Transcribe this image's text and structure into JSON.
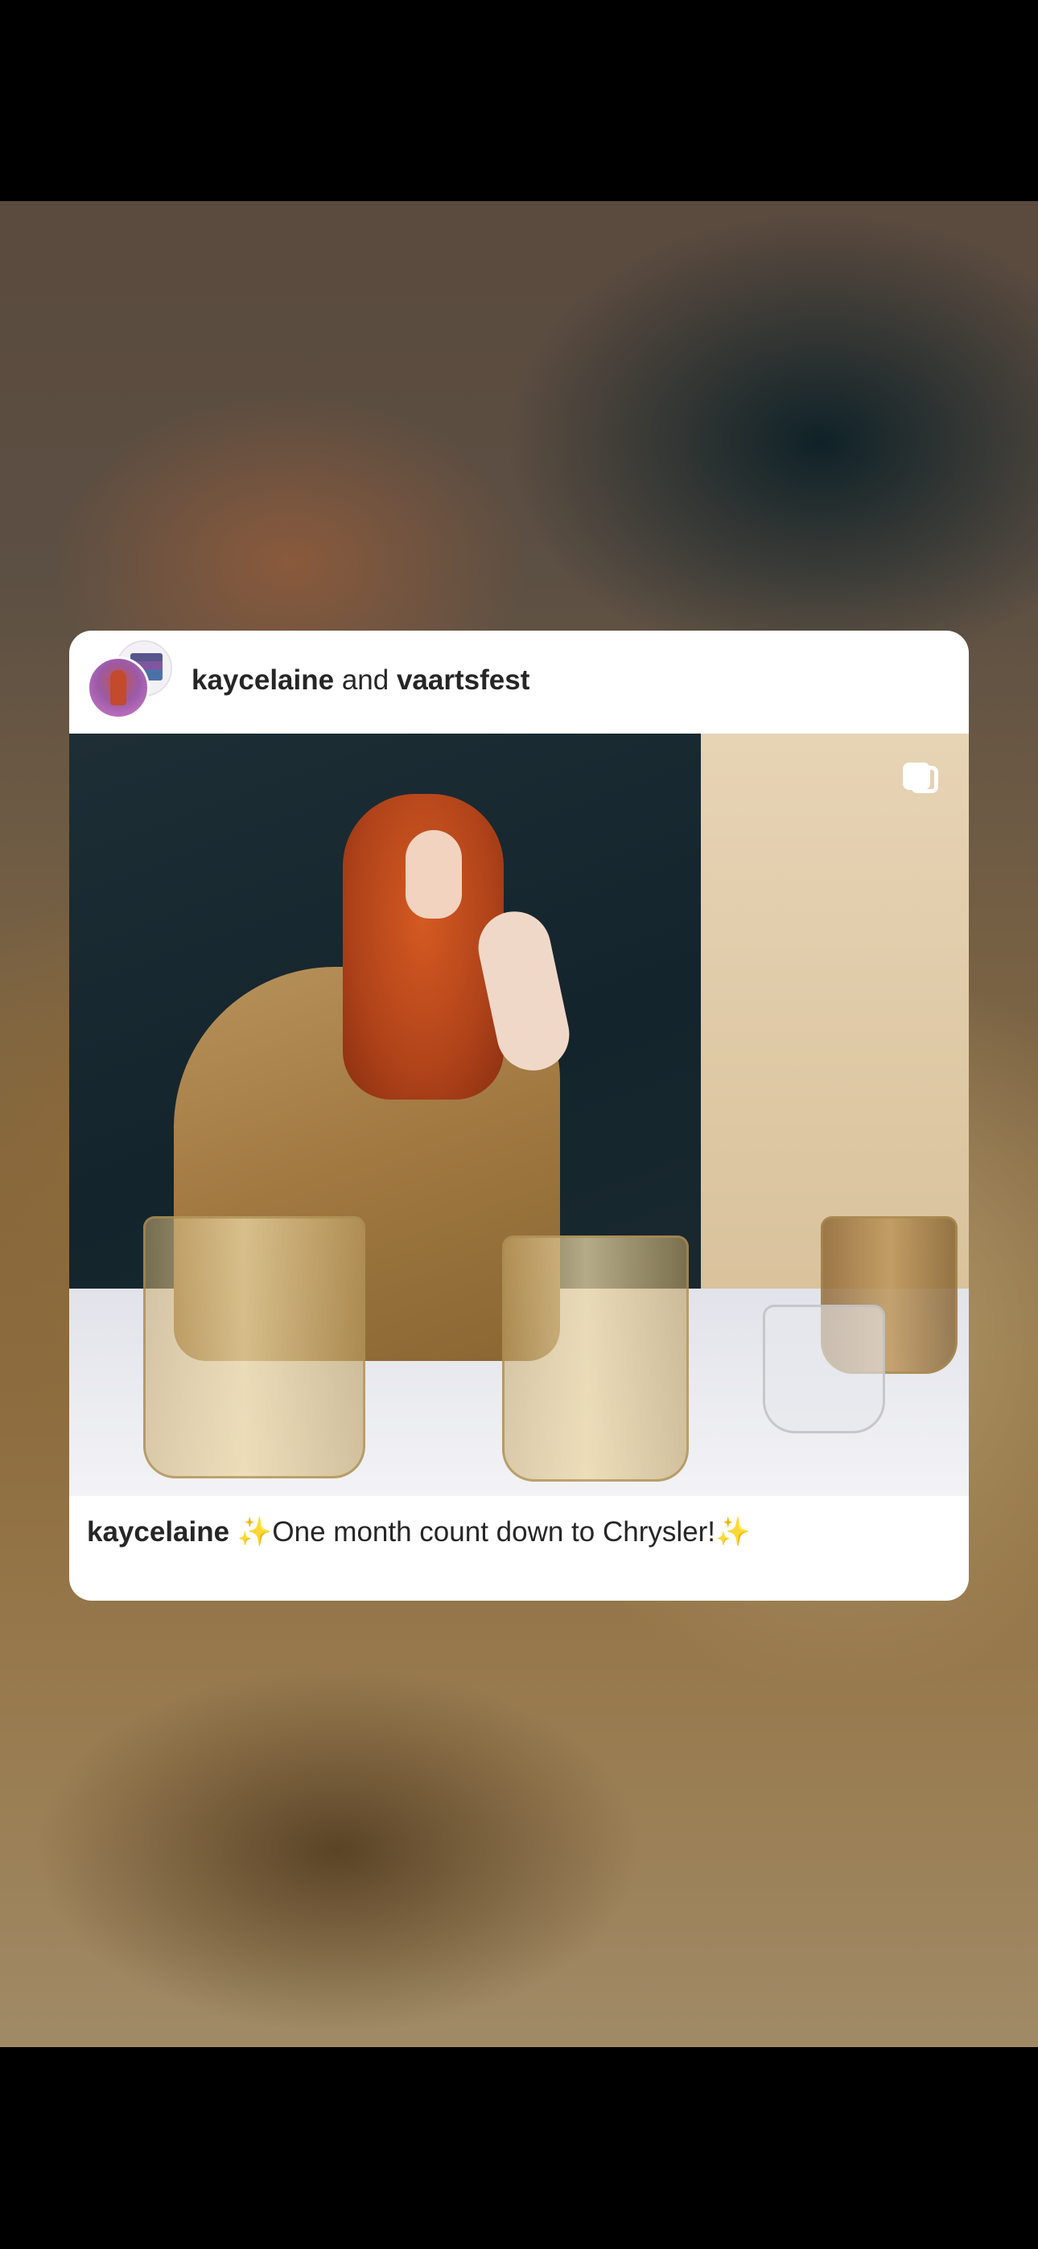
{
  "post": {
    "author": "kaycelaine",
    "joiner": "and",
    "collaborator": "vaartsfest",
    "caption_author": "kaycelaine",
    "caption_emoji_start": "✨",
    "caption_text": "One month count down to Chrysler!",
    "caption_emoji_end": "✨",
    "media_type_icon": "carousel-icon"
  }
}
